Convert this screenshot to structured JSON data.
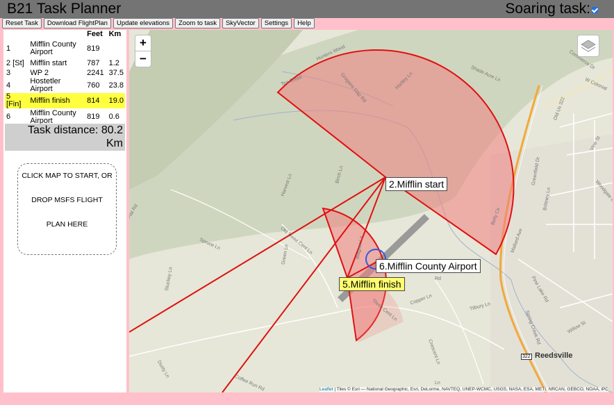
{
  "app": {
    "title": "B21 Task Planner",
    "soaring_label": "Soaring task:",
    "soaring_checked": true
  },
  "toolbar": {
    "reset": "Reset Task",
    "download": "Download FlightPlan",
    "elevations": "Update elevations",
    "zoom": "Zoom to task",
    "skyvector": "SkyVector",
    "settings": "Settings",
    "help": "Help"
  },
  "task_table": {
    "headers": [
      "",
      "",
      "Feet",
      "Km"
    ],
    "rows": [
      {
        "idx": "1",
        "name": "Mifflin County Airport",
        "feet": "819",
        "km": ""
      },
      {
        "idx": "2 [St]",
        "name": "Mifflin start",
        "feet": "787",
        "km": "1.2"
      },
      {
        "idx": "3",
        "name": "WP 2",
        "feet": "2241",
        "km": "37.5"
      },
      {
        "idx": "4",
        "name": "Hostetler Airport",
        "feet": "760",
        "km": "23.8"
      },
      {
        "idx": "5 [Fin]",
        "name": "Mifflin finish",
        "feet": "814",
        "km": "19.0"
      },
      {
        "idx": "6",
        "name": "Mifflin County Airport",
        "feet": "819",
        "km": "0.6"
      }
    ],
    "highlight_row": 4
  },
  "task_distance": {
    "line1": "Task distance: 80.2",
    "line2": "Km"
  },
  "drop_zone": {
    "line1": "CLICK MAP TO START, OR",
    "line2": "DROP MSFS FLIGHT",
    "line3": "PLAN HERE"
  },
  "map": {
    "zoom_in": "+",
    "zoom_out": "−",
    "labels": {
      "start": "2.Mifflin start",
      "airport": "6.Mifflin County Airport",
      "finish": "5.Mifflin finish"
    },
    "place_names": [
      "Reedsville",
      "322",
      "Hunters Wood",
      "Tea Creek",
      "Grogans Gap Rd",
      "Hartley Ln",
      "Shade Acre Ln",
      "Commerce Dr",
      "W Colonial",
      "Old Us 322",
      "Vine St",
      "Green Ln",
      "Harvest Ln",
      "Birch Ln",
      "Old Three Cent Ln",
      "Spruce Ln",
      "Three Cent Ln",
      "Copper Ln",
      "Tilbury Ln",
      "Stuckey Ln",
      "Dusty Ln",
      "Coffee Run Rd",
      "Flat Rd",
      "Wagner Ln",
      "Woodgate Ln",
      "Brittney Ln",
      "Greenfield Dr",
      "Belly Cir",
      "Mallard Ave",
      "Willow St",
      "Spring Creek Rd",
      "Pine Lake Rd",
      "Crescent Ln",
      "Rd",
      "Ln"
    ],
    "attribution_link": "Leaflet",
    "attribution_text": " | Tiles © Esri — National Geographic, Esri, DeLorme, NAVTEQ, UNEP-WCMC, USGS, NASA, ESA, METI, NRCAN, GEBCO, NOAA, iPC"
  },
  "colors": {
    "sector_fill": "#f08080",
    "sector_stroke": "#e01010",
    "highlight": "#ffff40",
    "background": "#ffc0cb",
    "header": "#747474"
  }
}
